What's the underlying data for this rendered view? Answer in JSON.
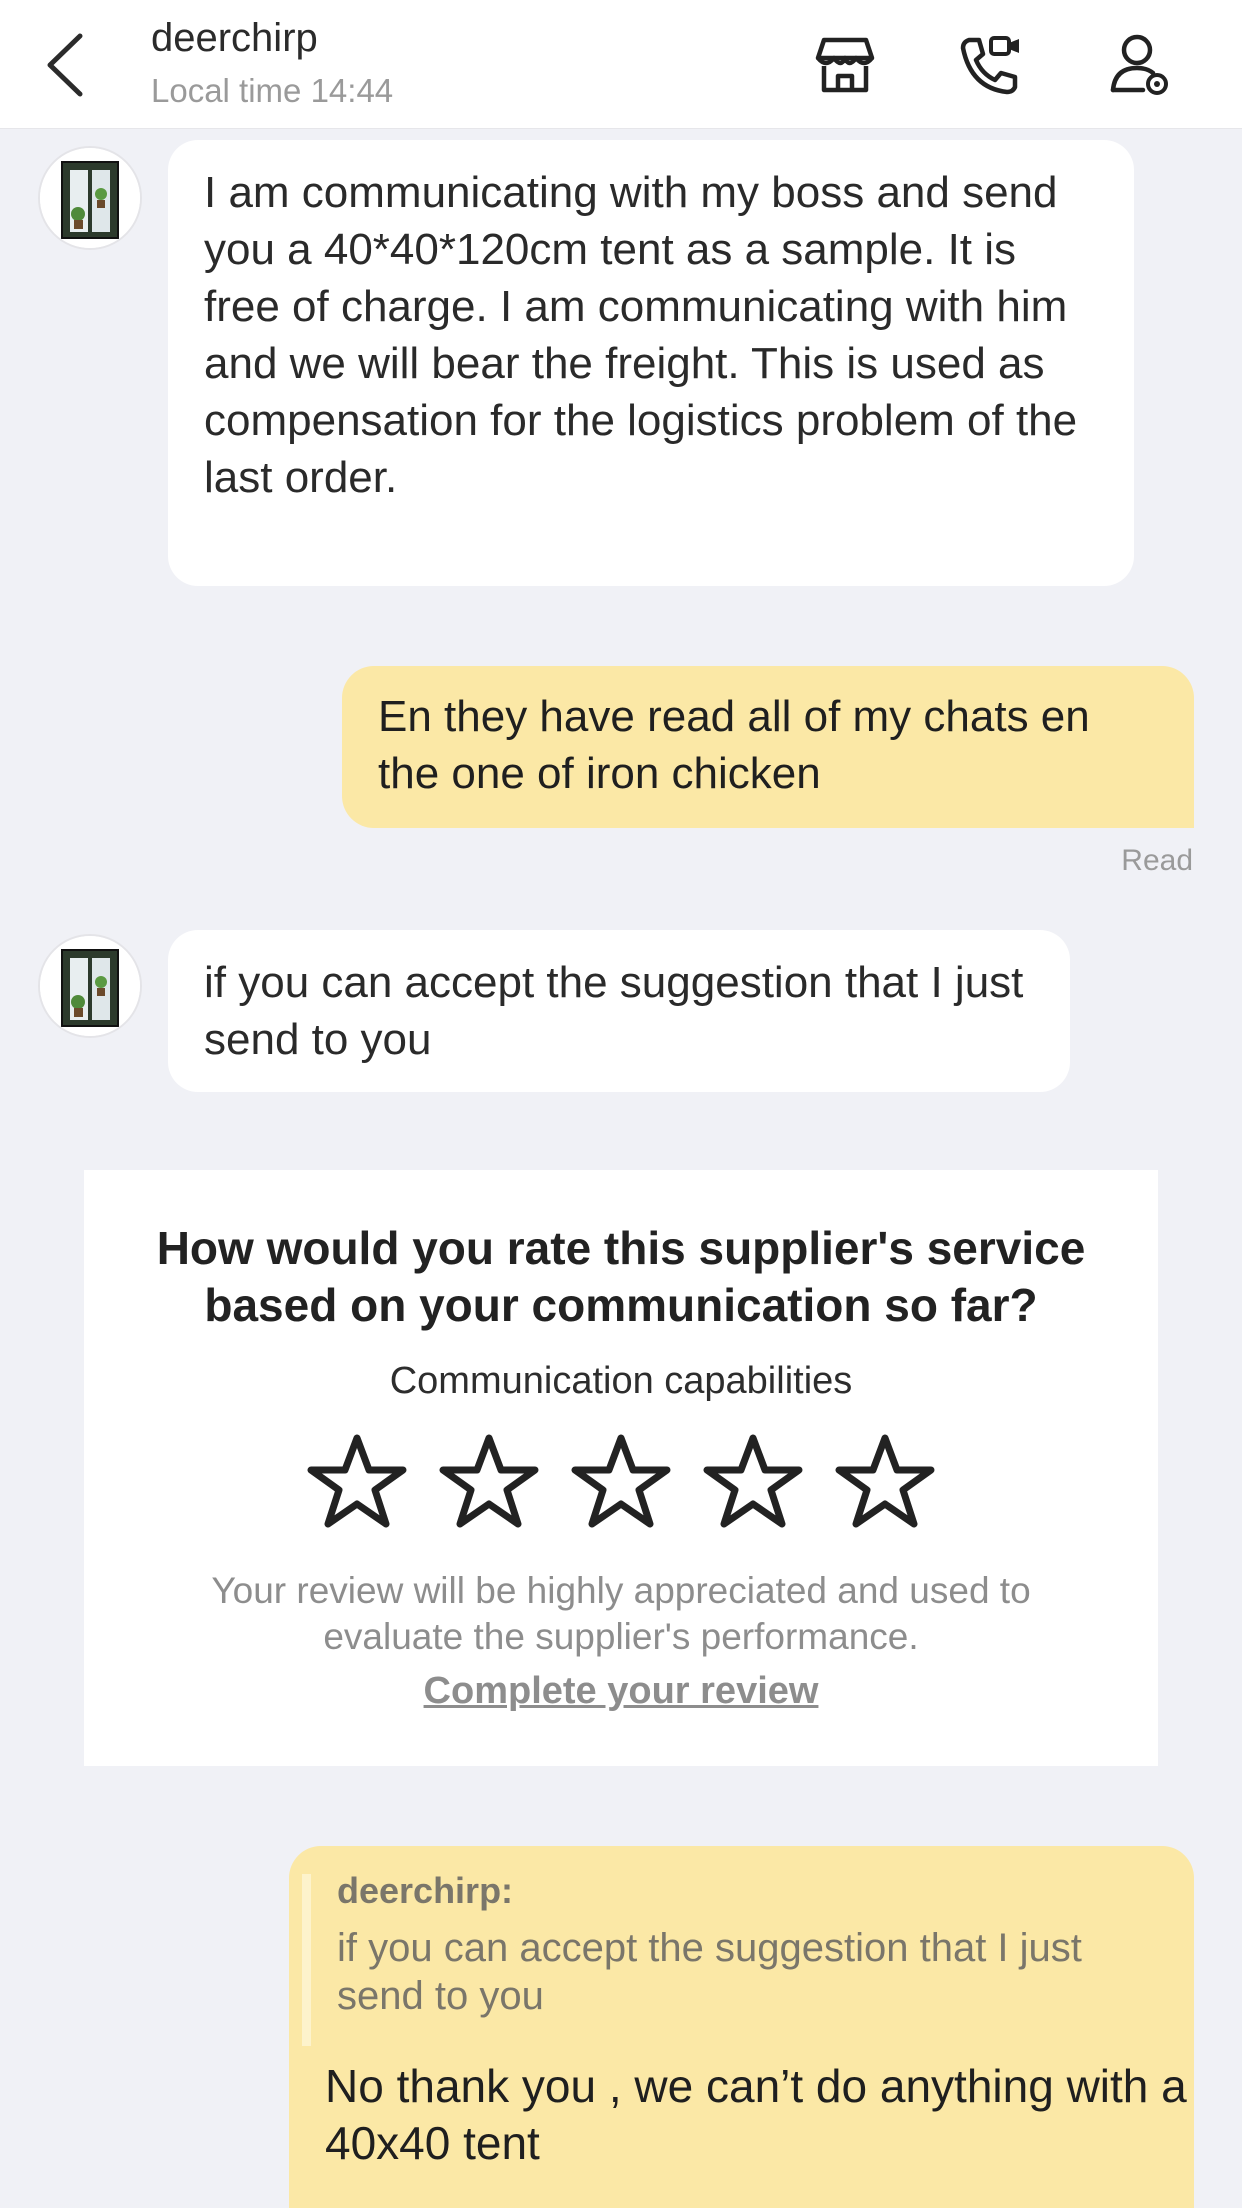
{
  "header": {
    "contact_name": "deerchirp",
    "local_time": "Local time 14:44",
    "icons": [
      "back-arrow-icon",
      "store-icon",
      "video-call-icon",
      "user-settings-icon"
    ]
  },
  "messages": [
    {
      "direction": "incoming",
      "text": "I am communicating with my boss and send you a 40*40*120cm tent as a sample. It is free of charge. I am communicating with him and we will bear the freight. This is used as compensation for the logistics problem of the last order."
    },
    {
      "direction": "outgoing",
      "text": "En they have read all of my chats en the one of iron chicken",
      "status": "Read"
    },
    {
      "direction": "incoming",
      "text": "if you can accept the suggestion that I just send to you"
    }
  ],
  "rating_card": {
    "question": "How would you rate this supplier's service based on your communication so far?",
    "subtitle": "Communication capabilities",
    "stars_total": 5,
    "stars_selected": 0,
    "note": "Your review will be highly appreciated and used to evaluate the supplier's performance.",
    "link": "Complete your review"
  },
  "reply": {
    "quote_author": "deerchirp:",
    "quote_text": "if you can accept the suggestion that I just send to you",
    "text": "No thank you , we can’t do anything with a 40x40 tent"
  },
  "colors": {
    "background": "#f0f1f6",
    "outgoing_bubble": "#fbe8a6",
    "incoming_bubble": "#ffffff",
    "muted_text": "#9a9a9a"
  }
}
